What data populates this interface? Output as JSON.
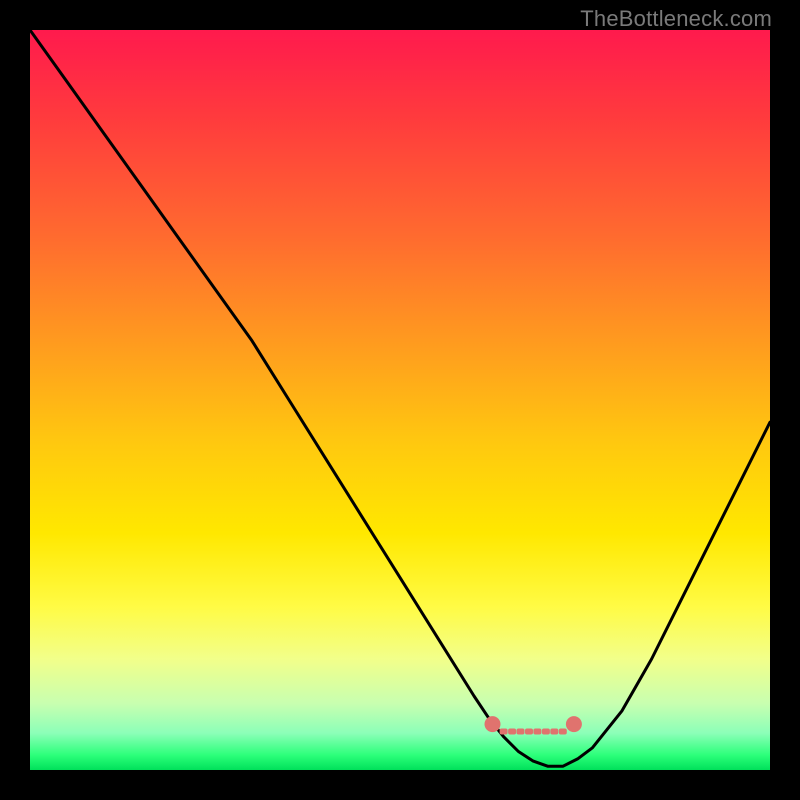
{
  "watermark": {
    "text": "TheBottleneck.com"
  },
  "chart_data": {
    "type": "line",
    "title": "",
    "xlabel": "",
    "ylabel": "",
    "xlim": [
      0,
      100
    ],
    "ylim": [
      0,
      100
    ],
    "grid": false,
    "legend": null,
    "series": [
      {
        "name": "curve",
        "x": [
          0,
          5,
          10,
          15,
          20,
          25,
          30,
          35,
          40,
          45,
          50,
          55,
          60,
          62,
          64,
          66,
          68,
          70,
          72,
          74,
          76,
          80,
          84,
          88,
          92,
          96,
          100
        ],
        "values": [
          100,
          93,
          86,
          79,
          72,
          65,
          58,
          50,
          42,
          34,
          26,
          18,
          10,
          7,
          4.5,
          2.5,
          1.2,
          0.5,
          0.5,
          1.5,
          3,
          8,
          15,
          23,
          31,
          39,
          47
        ],
        "color": "#000000"
      }
    ],
    "markers": [
      {
        "x": 62.5,
        "y": 6.2,
        "color": "#e0736e"
      },
      {
        "x": 73.5,
        "y": 6.2,
        "color": "#e0736e"
      }
    ],
    "flat_dots": {
      "y": 5.2,
      "x_start": 64,
      "x_end": 72,
      "count": 8,
      "color": "#e0736e"
    }
  }
}
